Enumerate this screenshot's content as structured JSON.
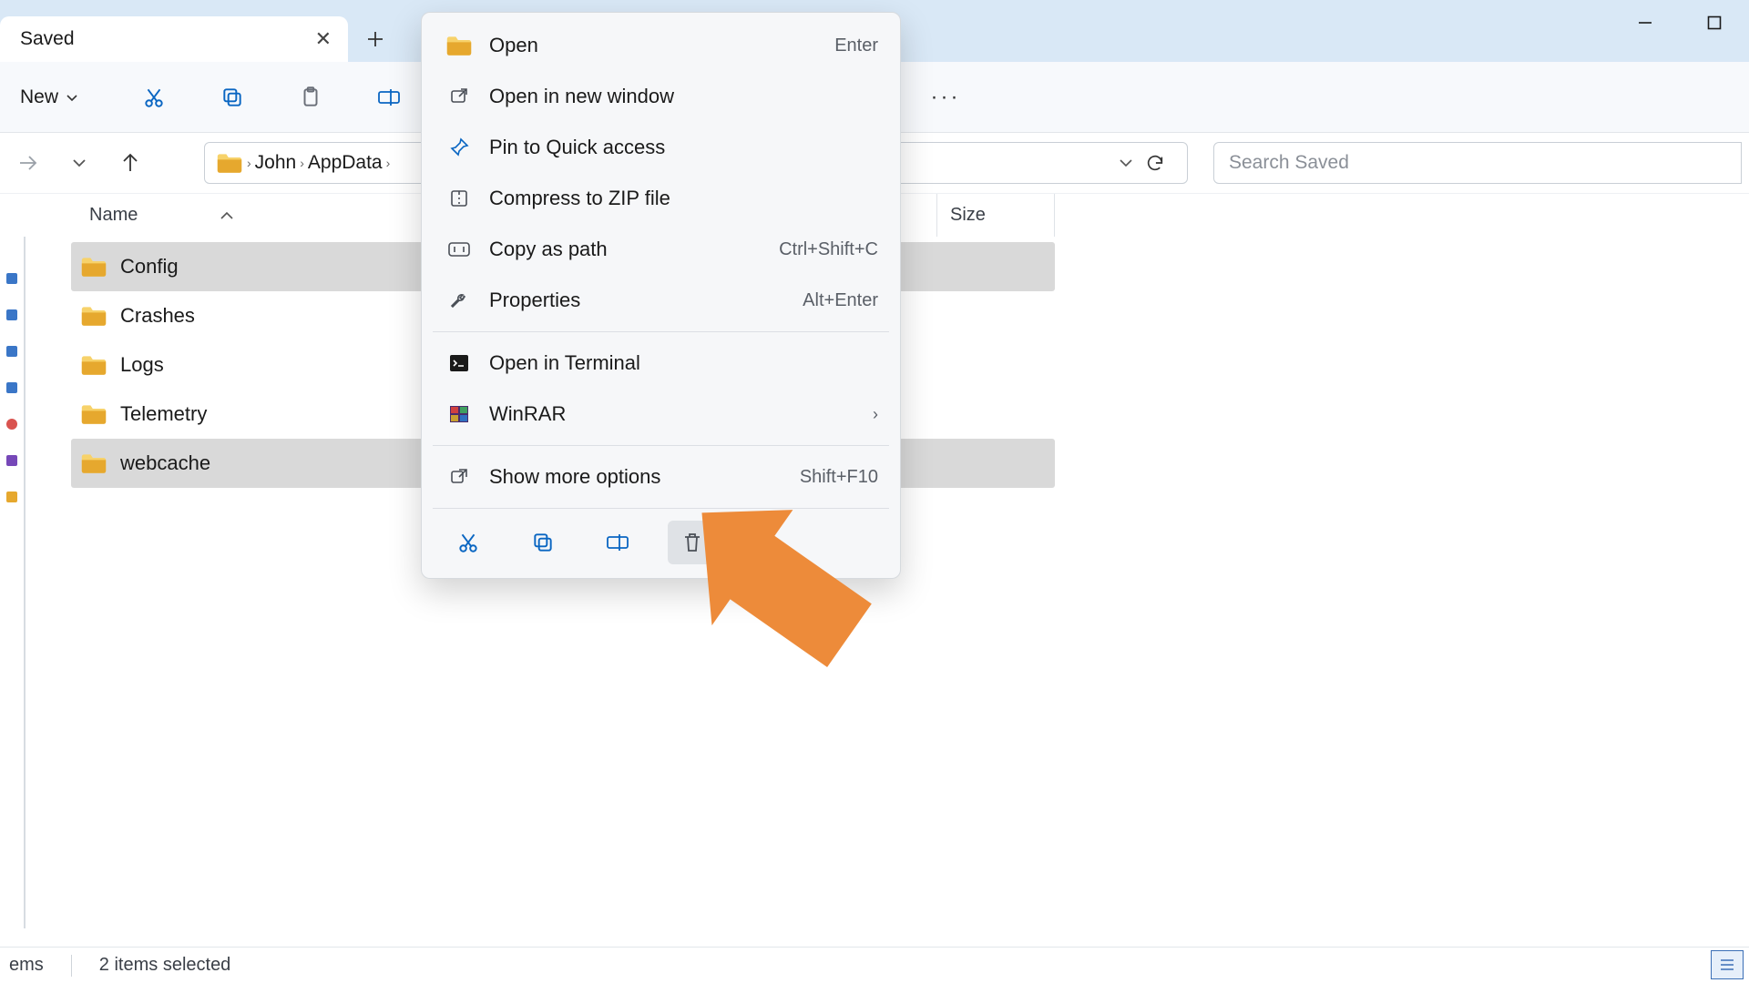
{
  "window": {
    "tab_title": "Saved"
  },
  "toolbar": {
    "new_label": "New",
    "more_dots": "···"
  },
  "breadcrumb": {
    "parts": [
      "John",
      "AppData"
    ]
  },
  "search": {
    "placeholder": "Search Saved"
  },
  "columns": {
    "name": "Name",
    "size": "Size"
  },
  "files": [
    {
      "name": "Config",
      "selected": true
    },
    {
      "name": "Crashes",
      "selected": false
    },
    {
      "name": "Logs",
      "selected": false
    },
    {
      "name": "Telemetry",
      "selected": false
    },
    {
      "name": "webcache",
      "selected": true
    }
  ],
  "context_menu": {
    "items": [
      {
        "icon": "folder",
        "label": "Open",
        "shortcut": "Enter"
      },
      {
        "icon": "newwin",
        "label": "Open in new window",
        "shortcut": ""
      },
      {
        "icon": "pin",
        "label": "Pin to Quick access",
        "shortcut": ""
      },
      {
        "icon": "zip",
        "label": "Compress to ZIP file",
        "shortcut": ""
      },
      {
        "icon": "path",
        "label": "Copy as path",
        "shortcut": "Ctrl+Shift+C"
      },
      {
        "icon": "wrench",
        "label": "Properties",
        "shortcut": "Alt+Enter"
      }
    ],
    "items2": [
      {
        "icon": "terminal",
        "label": "Open in Terminal",
        "shortcut": ""
      },
      {
        "icon": "winrar",
        "label": "WinRAR",
        "shortcut": "",
        "submenu": true
      }
    ],
    "items3": [
      {
        "icon": "more",
        "label": "Show more options",
        "shortcut": "Shift+F10"
      }
    ]
  },
  "status": {
    "items_suffix": "ems",
    "selected": "2 items selected"
  },
  "colors": {
    "accent": "#0a66c2",
    "titlebar": "#d9e8f6",
    "arrow": "#ed8b3a",
    "folder1": "#f7d26a",
    "folder2": "#e6a82e"
  }
}
